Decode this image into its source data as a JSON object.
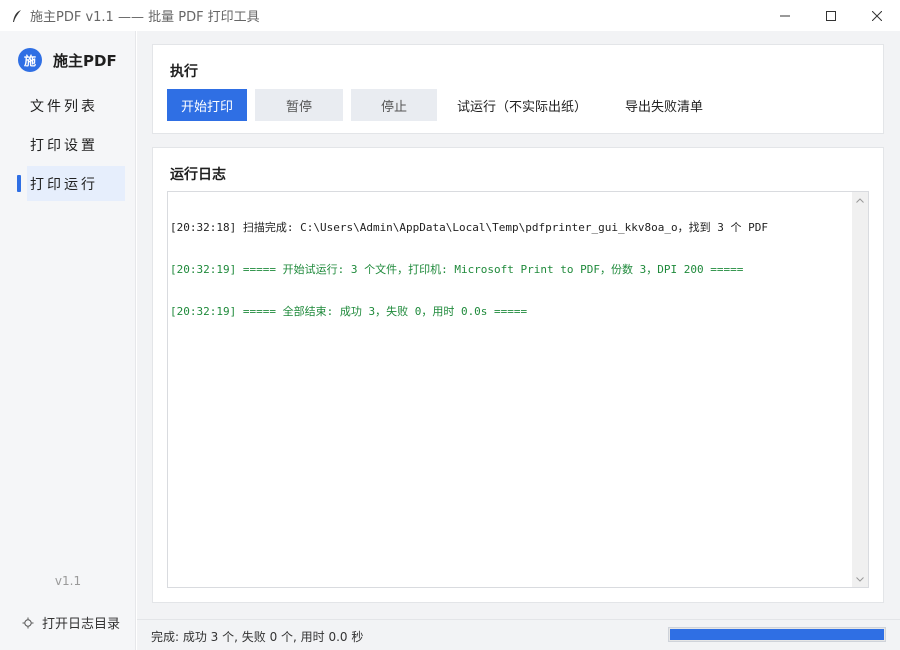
{
  "window": {
    "title": "施主PDF v1.1 —— 批量 PDF 打印工具",
    "app_icon": "feather-icon"
  },
  "sidebar": {
    "brand_logo": "施",
    "brand_name": "施主PDF",
    "items": [
      {
        "label": "文件列表",
        "active": false
      },
      {
        "label": "打印设置",
        "active": false
      },
      {
        "label": "打印运行",
        "active": true
      }
    ],
    "version": "v1.1",
    "open_log_label": "打开日志目录"
  },
  "exec": {
    "title": "执行",
    "start_label": "开始打印",
    "pause_label": "暂停",
    "stop_label": "停止",
    "dry_run_label": "试运行（不实际出纸）",
    "export_label": "导出失败清单"
  },
  "log": {
    "title": "运行日志",
    "lines": [
      {
        "text": "[20:32:18] 扫描完成: C:\\Users\\Admin\\AppData\\Local\\Temp\\pdfprinter_gui_kkv8oa_o，找到 3 个 PDF",
        "color": "#222222"
      },
      {
        "text": "[20:32:19] ===== 开始试运行: 3 个文件，打印机: Microsoft Print to PDF，份数 3，DPI 200 =====",
        "color": "#1f8a3b"
      },
      {
        "text": "[20:32:19] ===== 全部结束: 成功 3，失败 0，用时 0.0s =====",
        "color": "#1f8a3b"
      }
    ]
  },
  "status": {
    "text": "完成: 成功 3 个, 失败 0 个, 用时 0.0 秒",
    "progress_percent": 100
  },
  "colors": {
    "accent": "#2f6fe4",
    "log_success": "#1f8a3b"
  }
}
